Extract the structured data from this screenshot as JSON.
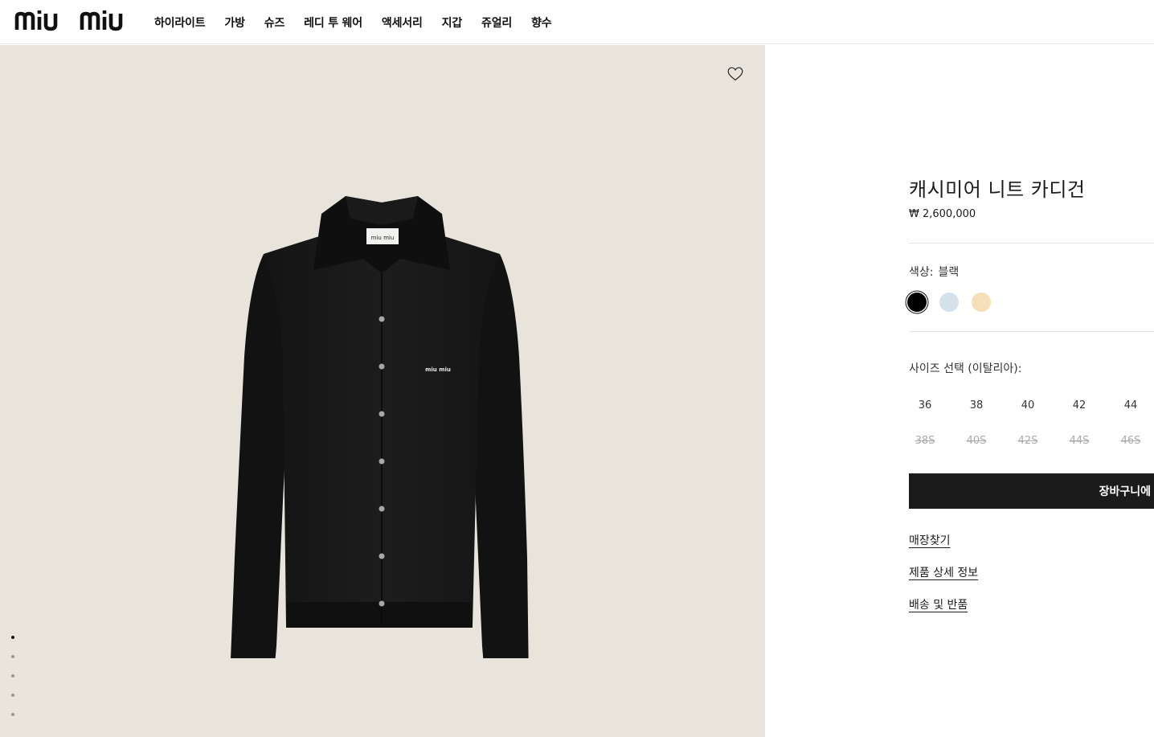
{
  "header": {
    "logo_text": "miu miu",
    "nav": [
      "하이라이트",
      "가방",
      "슈즈",
      "레디 투 웨어",
      "액세서리",
      "지갑",
      "쥬얼리",
      "향수"
    ]
  },
  "gallery": {
    "wishlist_icon": "heart-outline-icon",
    "garment_label": "miu miu",
    "chest_embroidery": "miu miu",
    "dot_count": 5,
    "active_dot": 0,
    "background": "#e8e4dc"
  },
  "product": {
    "title": "캐시미어 니트 카디건",
    "price": "₩ 2,600,000",
    "color_label": "색상:",
    "color_value": "블랙",
    "swatches": [
      {
        "name": "black",
        "hex": "#000000",
        "selected": true
      },
      {
        "name": "light-blue",
        "hex": "#d4e2ec",
        "selected": false
      },
      {
        "name": "cream",
        "hex": "#f5dfb8",
        "selected": false
      }
    ],
    "size_label": "사이즈 선택 (이탈리아):",
    "sizes_row1": [
      {
        "label": "36",
        "available": true
      },
      {
        "label": "38",
        "available": true
      },
      {
        "label": "40",
        "available": true
      },
      {
        "label": "42",
        "available": true
      },
      {
        "label": "44",
        "available": true
      }
    ],
    "sizes_row2": [
      {
        "label": "38S",
        "available": false
      },
      {
        "label": "40S",
        "available": false
      },
      {
        "label": "42S",
        "available": false
      },
      {
        "label": "44S",
        "available": false
      },
      {
        "label": "46S",
        "available": false
      }
    ],
    "cart_button": "장바구니에",
    "links": [
      "매장찾기",
      "제품 상세 정보",
      "배송 및 반품"
    ]
  }
}
